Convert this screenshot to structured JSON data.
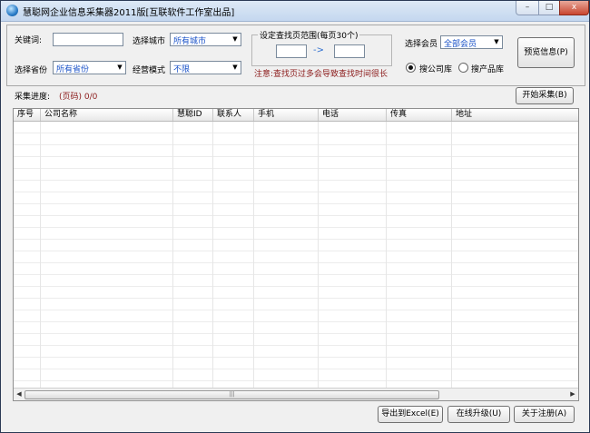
{
  "window": {
    "title": "慧聪网企业信息采集器2011版[互联软件工作室出品]",
    "minimize_glyph": "–",
    "maximize_glyph": "□",
    "close_glyph": "x"
  },
  "filters": {
    "keyword_label": "关键词:",
    "keyword_value": "",
    "city_label": "选择城市",
    "city_value": "所有城市",
    "province_label": "选择省份",
    "province_value": "所有省份",
    "mode_label": "经营模式",
    "mode_value": "不限",
    "range_legend": "设定查找页范围(每页30个)",
    "range_from": "",
    "range_arrow": "->",
    "range_to": "",
    "range_note": "注意:查找页过多会导致查找时间很长",
    "member_label": "选择会员",
    "member_value": "全部会员",
    "search_company_label": "搜公司库",
    "search_product_label": "搜产品库",
    "preview_button": "预览信息(P)"
  },
  "progress": {
    "label": "采集进度:",
    "value": "(页码) 0/0",
    "start_button": "开始采集(B)"
  },
  "table": {
    "columns": [
      "序号",
      "公司名称",
      "慧聪ID",
      "联系人",
      "手机",
      "电话",
      "传真",
      "地址"
    ],
    "rows": []
  },
  "footer": {
    "export_button": "导出到Excel(E)",
    "upgrade_button": "在线升级(U)",
    "about_button": "关于注册(A)"
  },
  "colors": {
    "value_blue": "#1a52c8",
    "note_red": "#8b1a1a",
    "progress_red": "#8b1a1a"
  }
}
